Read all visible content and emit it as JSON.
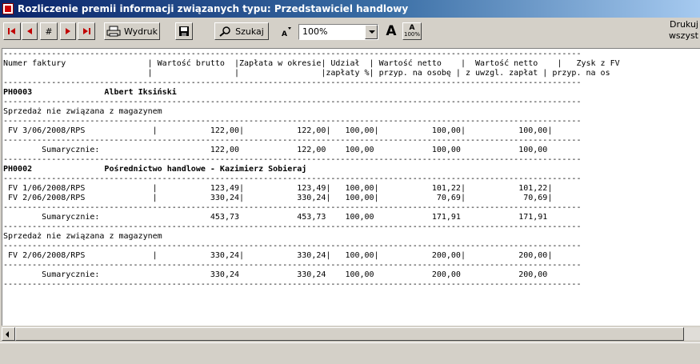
{
  "window": {
    "title": "Rozliczenie premii informacji związanych typu: Przedstawiciel handlowy"
  },
  "toolbar": {
    "page_nav_label": "#",
    "print_label": "Wydruk",
    "search_label": "Szukaj",
    "zoom_value": "100%",
    "zoom_in_label": "A",
    "zoom_reset_label": "100%",
    "print_all_line1": "Drukuj",
    "print_all_line2": "wszyst"
  },
  "report": {
    "lines": [
      {
        "t": "------------------------------------------------------------------------------------------------------------------------"
      },
      {
        "t": "Numer faktury                 | Wartość brutto  |Zapłata w okresie| Udział  | Wartość netto    |  Wartość netto    |   Zysk z FV"
      },
      {
        "t": "                              |                 |                 |zapłaty %| przyp. na osobę | z uwzgl. zapłat | przyp. na os"
      },
      {
        "t": "------------------------------------------------------------------------------------------------------------------------"
      },
      {
        "t": "PH0003               Albert Iksiński",
        "b": true
      },
      {
        "t": "------------------------------------------------------------------------------------------------------------------------"
      },
      {
        "t": "Sprzedaż nie związana z magazynem"
      },
      {
        "t": "------------------------------------------------------------------------------------------------------------------------"
      },
      {
        "t": " FV 3/06/2008/RPS              |           122,00|           122,00|   100,00|           100,00|           100,00|"
      },
      {
        "t": "------------------------------------------------------------------------------------------------------------------------"
      },
      {
        "t": "        Sumarycznie:                       122,00            122,00    100,00            100,00            100,00"
      },
      {
        "t": "------------------------------------------------------------------------------------------------------------------------"
      },
      {
        "t": "PH0002               Pośrednictwo handlowe - Kazimierz Sobieraj",
        "b": true
      },
      {
        "t": "------------------------------------------------------------------------------------------------------------------------"
      },
      {
        "t": " FV 1/06/2008/RPS              |           123,49|           123,49|   100,00|           101,22|           101,22|"
      },
      {
        "t": " FV 2/06/2008/RPS              |           330,24|           330,24|   100,00|            70,69|            70,69|"
      },
      {
        "t": "------------------------------------------------------------------------------------------------------------------------"
      },
      {
        "t": "        Sumarycznie:                       453,73            453,73    100,00            171,91            171,91"
      },
      {
        "t": "------------------------------------------------------------------------------------------------------------------------"
      },
      {
        "t": "Sprzedaż nie związana z magazynem"
      },
      {
        "t": "------------------------------------------------------------------------------------------------------------------------"
      },
      {
        "t": " FV 2/06/2008/RPS              |           330,24|           330,24|   100,00|           200,00|           200,00|"
      },
      {
        "t": "------------------------------------------------------------------------------------------------------------------------"
      },
      {
        "t": "        Sumarycznie:                       330,24            330,24    100,00            200,00            200,00"
      },
      {
        "t": "------------------------------------------------------------------------------------------------------------------------"
      }
    ]
  }
}
